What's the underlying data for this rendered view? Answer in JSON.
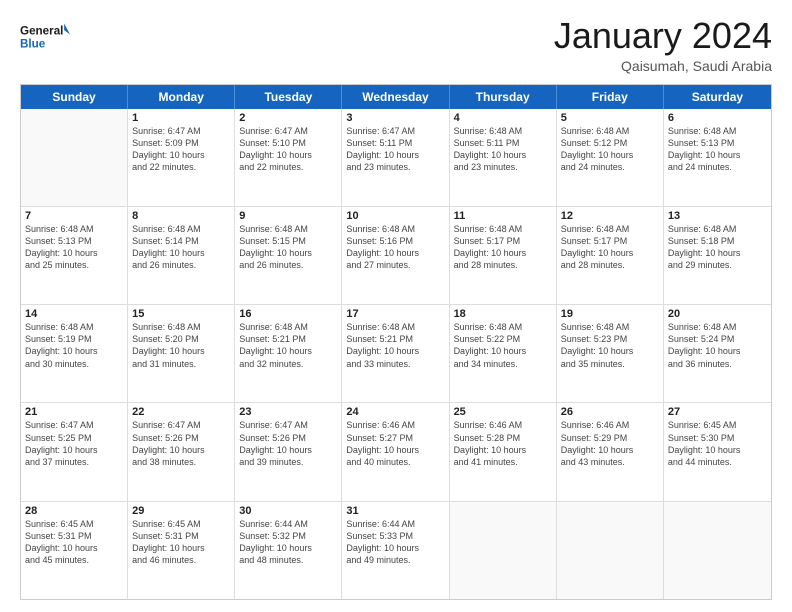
{
  "header": {
    "logo_general": "General",
    "logo_blue": "Blue",
    "month_title": "January 2024",
    "location": "Qaisumah, Saudi Arabia"
  },
  "days_of_week": [
    "Sunday",
    "Monday",
    "Tuesday",
    "Wednesday",
    "Thursday",
    "Friday",
    "Saturday"
  ],
  "weeks": [
    [
      {
        "day": "",
        "data": []
      },
      {
        "day": "1",
        "data": [
          "Sunrise: 6:47 AM",
          "Sunset: 5:09 PM",
          "Daylight: 10 hours",
          "and 22 minutes."
        ]
      },
      {
        "day": "2",
        "data": [
          "Sunrise: 6:47 AM",
          "Sunset: 5:10 PM",
          "Daylight: 10 hours",
          "and 22 minutes."
        ]
      },
      {
        "day": "3",
        "data": [
          "Sunrise: 6:47 AM",
          "Sunset: 5:11 PM",
          "Daylight: 10 hours",
          "and 23 minutes."
        ]
      },
      {
        "day": "4",
        "data": [
          "Sunrise: 6:48 AM",
          "Sunset: 5:11 PM",
          "Daylight: 10 hours",
          "and 23 minutes."
        ]
      },
      {
        "day": "5",
        "data": [
          "Sunrise: 6:48 AM",
          "Sunset: 5:12 PM",
          "Daylight: 10 hours",
          "and 24 minutes."
        ]
      },
      {
        "day": "6",
        "data": [
          "Sunrise: 6:48 AM",
          "Sunset: 5:13 PM",
          "Daylight: 10 hours",
          "and 24 minutes."
        ]
      }
    ],
    [
      {
        "day": "7",
        "data": [
          "Sunrise: 6:48 AM",
          "Sunset: 5:13 PM",
          "Daylight: 10 hours",
          "and 25 minutes."
        ]
      },
      {
        "day": "8",
        "data": [
          "Sunrise: 6:48 AM",
          "Sunset: 5:14 PM",
          "Daylight: 10 hours",
          "and 26 minutes."
        ]
      },
      {
        "day": "9",
        "data": [
          "Sunrise: 6:48 AM",
          "Sunset: 5:15 PM",
          "Daylight: 10 hours",
          "and 26 minutes."
        ]
      },
      {
        "day": "10",
        "data": [
          "Sunrise: 6:48 AM",
          "Sunset: 5:16 PM",
          "Daylight: 10 hours",
          "and 27 minutes."
        ]
      },
      {
        "day": "11",
        "data": [
          "Sunrise: 6:48 AM",
          "Sunset: 5:17 PM",
          "Daylight: 10 hours",
          "and 28 minutes."
        ]
      },
      {
        "day": "12",
        "data": [
          "Sunrise: 6:48 AM",
          "Sunset: 5:17 PM",
          "Daylight: 10 hours",
          "and 28 minutes."
        ]
      },
      {
        "day": "13",
        "data": [
          "Sunrise: 6:48 AM",
          "Sunset: 5:18 PM",
          "Daylight: 10 hours",
          "and 29 minutes."
        ]
      }
    ],
    [
      {
        "day": "14",
        "data": [
          "Sunrise: 6:48 AM",
          "Sunset: 5:19 PM",
          "Daylight: 10 hours",
          "and 30 minutes."
        ]
      },
      {
        "day": "15",
        "data": [
          "Sunrise: 6:48 AM",
          "Sunset: 5:20 PM",
          "Daylight: 10 hours",
          "and 31 minutes."
        ]
      },
      {
        "day": "16",
        "data": [
          "Sunrise: 6:48 AM",
          "Sunset: 5:21 PM",
          "Daylight: 10 hours",
          "and 32 minutes."
        ]
      },
      {
        "day": "17",
        "data": [
          "Sunrise: 6:48 AM",
          "Sunset: 5:21 PM",
          "Daylight: 10 hours",
          "and 33 minutes."
        ]
      },
      {
        "day": "18",
        "data": [
          "Sunrise: 6:48 AM",
          "Sunset: 5:22 PM",
          "Daylight: 10 hours",
          "and 34 minutes."
        ]
      },
      {
        "day": "19",
        "data": [
          "Sunrise: 6:48 AM",
          "Sunset: 5:23 PM",
          "Daylight: 10 hours",
          "and 35 minutes."
        ]
      },
      {
        "day": "20",
        "data": [
          "Sunrise: 6:48 AM",
          "Sunset: 5:24 PM",
          "Daylight: 10 hours",
          "and 36 minutes."
        ]
      }
    ],
    [
      {
        "day": "21",
        "data": [
          "Sunrise: 6:47 AM",
          "Sunset: 5:25 PM",
          "Daylight: 10 hours",
          "and 37 minutes."
        ]
      },
      {
        "day": "22",
        "data": [
          "Sunrise: 6:47 AM",
          "Sunset: 5:26 PM",
          "Daylight: 10 hours",
          "and 38 minutes."
        ]
      },
      {
        "day": "23",
        "data": [
          "Sunrise: 6:47 AM",
          "Sunset: 5:26 PM",
          "Daylight: 10 hours",
          "and 39 minutes."
        ]
      },
      {
        "day": "24",
        "data": [
          "Sunrise: 6:46 AM",
          "Sunset: 5:27 PM",
          "Daylight: 10 hours",
          "and 40 minutes."
        ]
      },
      {
        "day": "25",
        "data": [
          "Sunrise: 6:46 AM",
          "Sunset: 5:28 PM",
          "Daylight: 10 hours",
          "and 41 minutes."
        ]
      },
      {
        "day": "26",
        "data": [
          "Sunrise: 6:46 AM",
          "Sunset: 5:29 PM",
          "Daylight: 10 hours",
          "and 43 minutes."
        ]
      },
      {
        "day": "27",
        "data": [
          "Sunrise: 6:45 AM",
          "Sunset: 5:30 PM",
          "Daylight: 10 hours",
          "and 44 minutes."
        ]
      }
    ],
    [
      {
        "day": "28",
        "data": [
          "Sunrise: 6:45 AM",
          "Sunset: 5:31 PM",
          "Daylight: 10 hours",
          "and 45 minutes."
        ]
      },
      {
        "day": "29",
        "data": [
          "Sunrise: 6:45 AM",
          "Sunset: 5:31 PM",
          "Daylight: 10 hours",
          "and 46 minutes."
        ]
      },
      {
        "day": "30",
        "data": [
          "Sunrise: 6:44 AM",
          "Sunset: 5:32 PM",
          "Daylight: 10 hours",
          "and 48 minutes."
        ]
      },
      {
        "day": "31",
        "data": [
          "Sunrise: 6:44 AM",
          "Sunset: 5:33 PM",
          "Daylight: 10 hours",
          "and 49 minutes."
        ]
      },
      {
        "day": "",
        "data": []
      },
      {
        "day": "",
        "data": []
      },
      {
        "day": "",
        "data": []
      }
    ]
  ]
}
